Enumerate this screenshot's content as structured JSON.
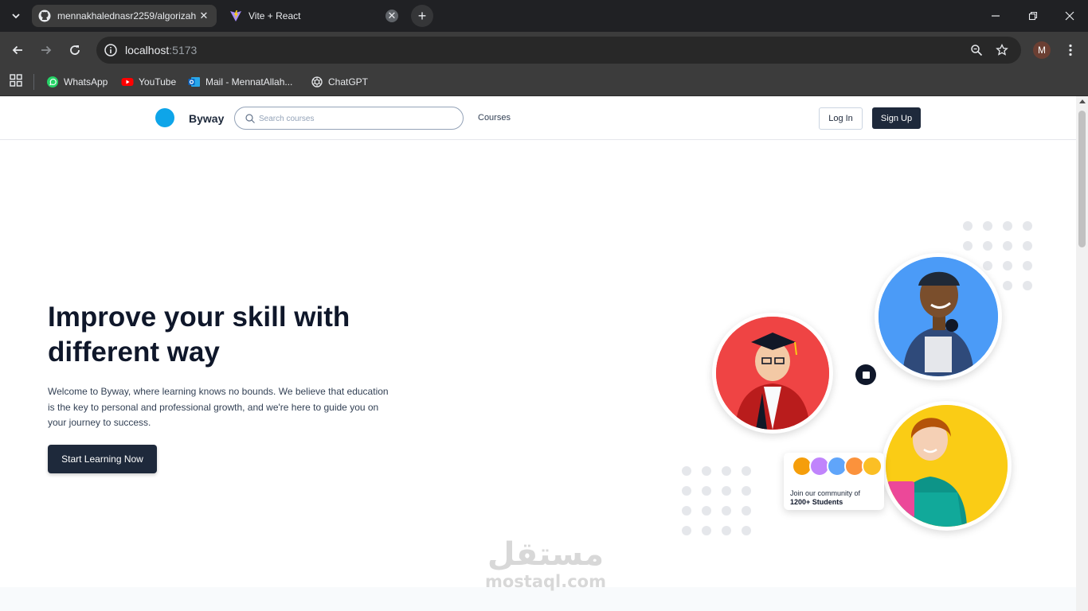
{
  "browser": {
    "tabs": [
      {
        "title": "mennakhalednasr2259/algorizah",
        "active": true
      },
      {
        "title": "Vite + React",
        "active": false
      }
    ],
    "address": {
      "host": "localhost",
      "port": ":5173"
    },
    "bookmarks": [
      {
        "label": "WhatsApp"
      },
      {
        "label": "YouTube"
      },
      {
        "label": "Mail - MennatAllah..."
      },
      {
        "label": "ChatGPT"
      }
    ],
    "profile_initial": "M"
  },
  "site": {
    "brand": "Byway",
    "search_placeholder": "Search courses",
    "nav_courses": "Courses",
    "login": "Log In",
    "signup": "Sign Up"
  },
  "hero": {
    "title_line1": "Improve your skill with",
    "title_line2": "different way",
    "description": "Welcome to Byway, where learning knows no bounds. We believe that education is the key to personal and professional growth, and we're here to guide you on your journey to success.",
    "cta": "Start Learning Now"
  },
  "community": {
    "line1": "Join our community of",
    "line2": "1200+ Students"
  },
  "watermark": {
    "arabic": "مستقل",
    "latin": "mostaql.com"
  },
  "colors": {
    "brand_dot": "#0ea5e9",
    "dark": "#1e293b",
    "circle_red": "#ef4444",
    "circle_blue": "#4b9bf7",
    "circle_yellow": "#facc15"
  }
}
